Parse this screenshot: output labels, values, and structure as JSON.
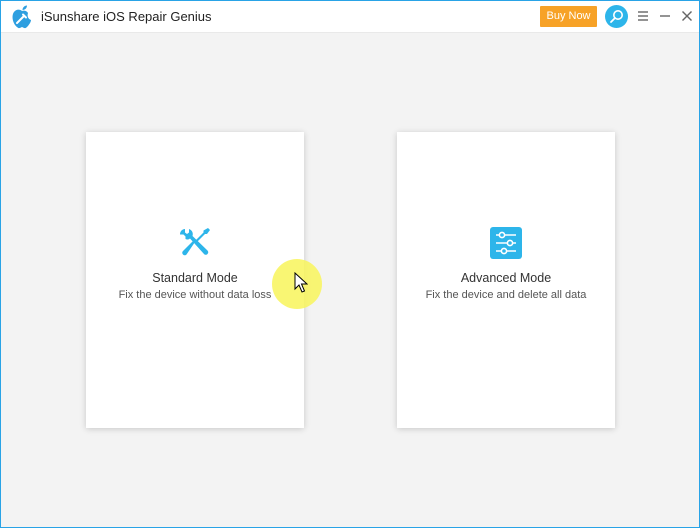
{
  "app": {
    "title": "iSunshare iOS Repair Genius",
    "logo_icon": "apple-wrench-logo"
  },
  "titlebar": {
    "buy_label": "Buy Now",
    "search_icon": "search-icon",
    "menu_icon": "hamburger-menu-icon",
    "minimize_icon": "minimize-icon",
    "close_icon": "close-icon"
  },
  "modes": [
    {
      "title": "Standard Mode",
      "description": "Fix the device without data loss",
      "icon": "tools-icon"
    },
    {
      "title": "Advanced Mode",
      "description": "Fix the device and delete all data",
      "icon": "sliders-icon"
    }
  ],
  "colors": {
    "accent": "#2db5ea",
    "buy": "#f7a227",
    "window_border": "#29a3e6"
  }
}
